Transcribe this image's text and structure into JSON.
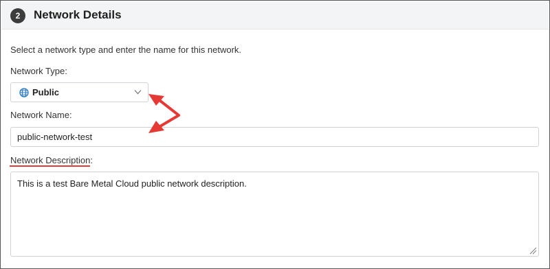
{
  "section": {
    "step_number": "2",
    "title": "Network Details"
  },
  "intro_text": "Select a network type and enter the name for this network.",
  "network_type": {
    "label": "Network Type:",
    "selected_value": "Public",
    "icon": "globe-icon"
  },
  "network_name": {
    "label": "Network Name:",
    "value": "public-network-test"
  },
  "network_description": {
    "label": "Network Description:",
    "value": "This is a test Bare Metal Cloud public network description."
  },
  "colors": {
    "annotation": "#e53935",
    "header_bg": "#f3f4f5",
    "globe": "#2a79c4"
  }
}
